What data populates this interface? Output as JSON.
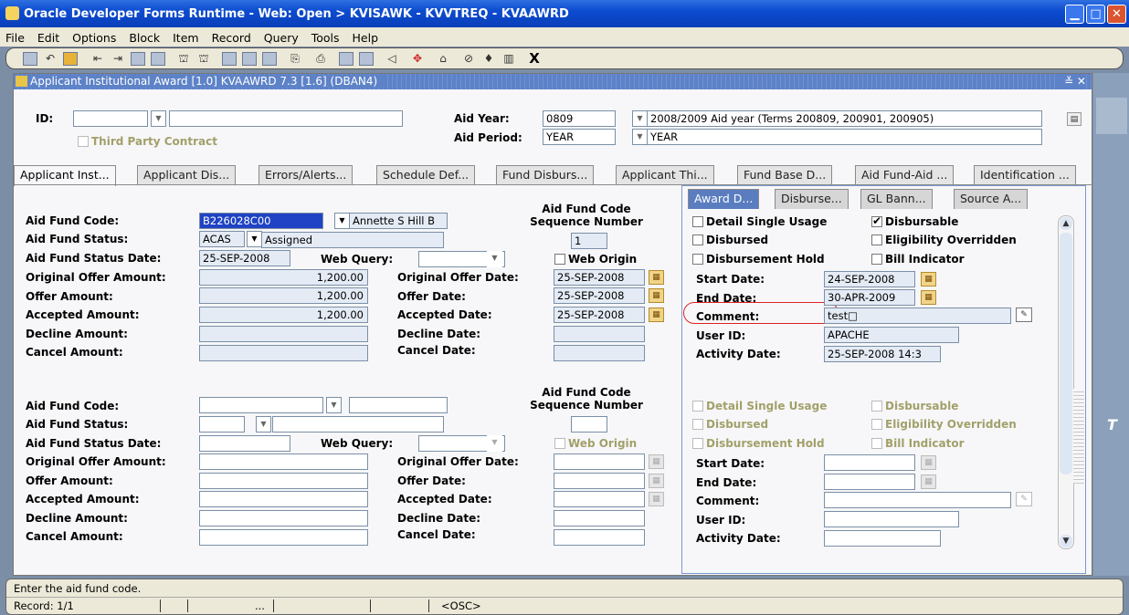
{
  "window": {
    "title": "Oracle Developer Forms Runtime - Web:  Open > KVISAWK - KVVTREQ - KVAAWRD"
  },
  "menu": [
    "File",
    "Edit",
    "Options",
    "Block",
    "Item",
    "Record",
    "Query",
    "Tools",
    "Help"
  ],
  "toolbar_last": "X",
  "form": {
    "title": "Applicant Institutional Award  [1.0]  KVAAWRD  7.3  [1.6]  (DBAN4)",
    "title_controls": "≚ ✕"
  },
  "key": {
    "id_label": "ID:",
    "id_value": "",
    "name_value": "",
    "third_party_label": "Third Party Contract",
    "aid_year_label": "Aid Year:",
    "aid_year_value": "0809",
    "aid_year_desc": "2008/2009 Aid year (Terms 200809, 200901, 200905)",
    "aid_period_label": "Aid Period:",
    "aid_period_value": "YEAR",
    "aid_period_desc": "YEAR"
  },
  "tabs": [
    "Applicant Inst...",
    "Applicant Dis...",
    "Errors/Alerts...",
    "Schedule Def...",
    "Fund Disburs...",
    "Applicant Thi...",
    "Fund Base D...",
    "Aid Fund-Aid ...",
    "Identification ..."
  ],
  "labels": {
    "aid_fund_code": "Aid Fund Code:",
    "aid_fund_status": "Aid Fund Status:",
    "aid_fund_status_date": "Aid Fund Status Date:",
    "original_offer_amount": "Original Offer Amount:",
    "offer_amount": "Offer Amount:",
    "accepted_amount": "Accepted Amount:",
    "decline_amount": "Decline Amount:",
    "cancel_amount": "Cancel Amount:",
    "seq_line1": "Aid Fund Code",
    "seq_line2": "Sequence Number",
    "web_query": "Web Query:",
    "web_origin": "Web Origin",
    "original_offer_date": "Original Offer Date:",
    "offer_date": "Offer Date:",
    "accepted_date": "Accepted Date:",
    "decline_date": "Decline Date:",
    "cancel_date": "Cancel Date:"
  },
  "record1": {
    "fund_code": "B226028C00",
    "fund_desc": "Annette S Hill B",
    "status": "ACAS",
    "status_desc": "Assigned",
    "status_date": "25-SEP-2008",
    "seq": "1",
    "web_query": "",
    "orig_offer_amt": "1,200.00",
    "offer_amt": "1,200.00",
    "accepted_amt": "1,200.00",
    "orig_offer_date": "25-SEP-2008",
    "offer_date": "25-SEP-2008",
    "accepted_date": "25-SEP-2008"
  },
  "rtabs": [
    "Award D...",
    "Disburse...",
    "GL Bann...",
    "Source A..."
  ],
  "rlabels": {
    "detail_single_usage": "Detail Single Usage",
    "disbursable": "Disbursable",
    "disbursed": "Disbursed",
    "eligibility_overridden": "Eligibility Overridden",
    "disbursement_hold": "Disbursement Hold",
    "bill_indicator": "Bill Indicator",
    "start_date": "Start Date:",
    "end_date": "End Date:",
    "comment": "Comment:",
    "user_id": "User ID:",
    "activity_date": "Activity Date:"
  },
  "rrecord1": {
    "start_date": "24-SEP-2008",
    "end_date": "30-APR-2009",
    "comment": "test□",
    "user_id": "APACHE",
    "activity_date": "25-SEP-2008 14:3"
  },
  "status": {
    "message": "Enter the aid fund code.",
    "record": "Record: 1/1",
    "mid": "...",
    "osc": "<OSC>"
  }
}
